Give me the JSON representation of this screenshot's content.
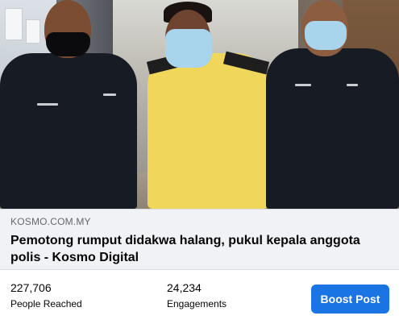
{
  "link_preview": {
    "image_alt": "Photo: man in yellow shirt and face mask escorted by two police officers",
    "domain": "KOSMO.COM.MY",
    "headline": "Pemotong rumput didakwa halang, pukul kepala anggota polis - Kosmo Digital"
  },
  "stats": {
    "reached": {
      "value": "227,706",
      "label": "People Reached"
    },
    "engagements": {
      "value": "24,234",
      "label": "Engagements"
    }
  },
  "actions": {
    "boost_label": "Boost Post"
  },
  "colors": {
    "accent": "#1b74e4",
    "meta_bg": "#f0f2f5",
    "muted_text": "#65676b"
  }
}
